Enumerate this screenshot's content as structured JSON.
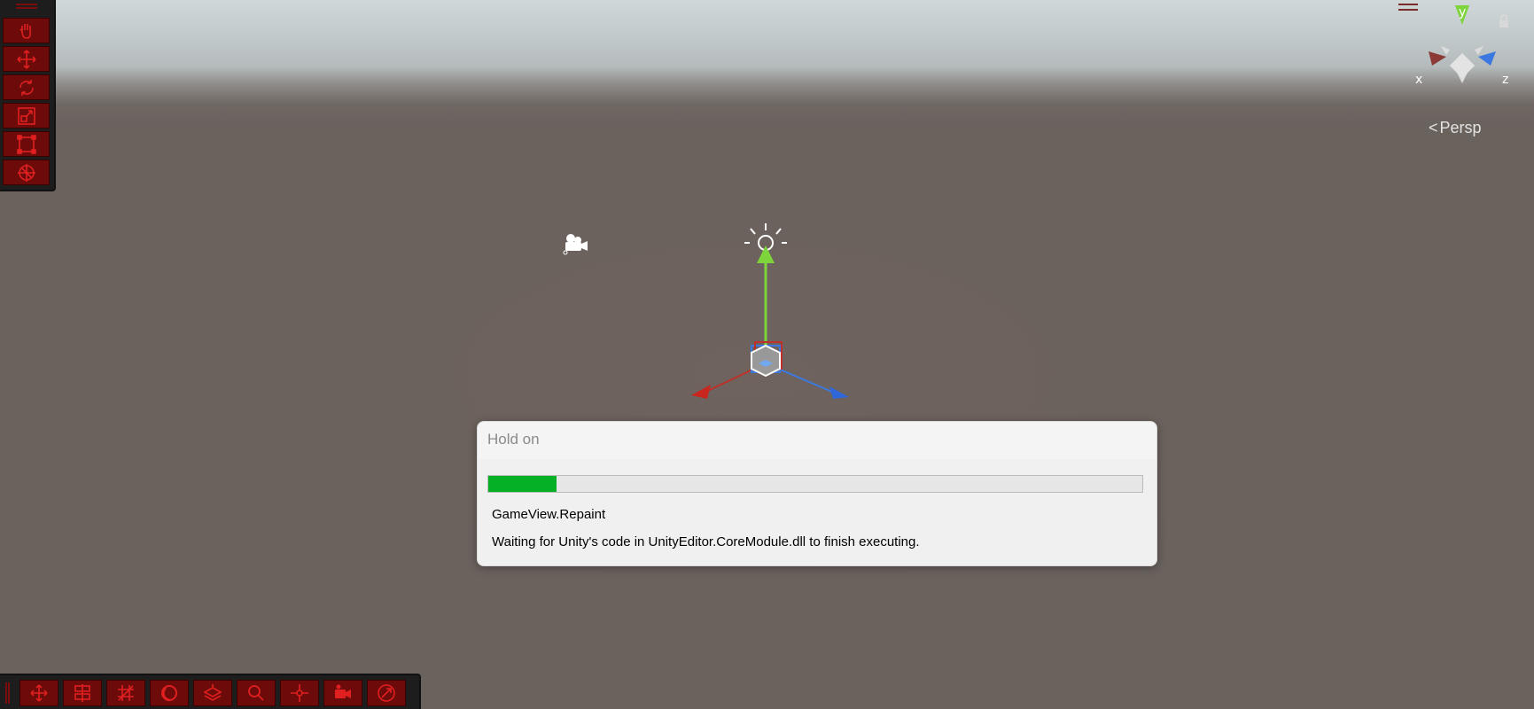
{
  "scene_view": {
    "projection_label": "Persp",
    "axis_labels": {
      "x": "x",
      "y": "y",
      "z": "z"
    },
    "colors": {
      "x_axis": "#d4332b",
      "y_axis": "#7ed43b",
      "z_axis": "#3b78e0",
      "toolbar_accent": "#6d0a0a"
    }
  },
  "left_toolbar": {
    "tools": [
      "hand-tool",
      "move-tool",
      "rotate-tool",
      "scale-tool",
      "rect-tool",
      "transform-tool"
    ]
  },
  "bottom_toolbar": {
    "tools": [
      "move-view",
      "layout",
      "grid-snap",
      "sphere",
      "layers",
      "search",
      "pivot",
      "scene-camera",
      "compass"
    ]
  },
  "dialog": {
    "title": "Hold on",
    "progress": 0.105,
    "progress_color": "#06b025",
    "line1": "GameView.Repaint",
    "line2": "Waiting for Unity's code in UnityEditor.CoreModule.dll to finish executing."
  }
}
